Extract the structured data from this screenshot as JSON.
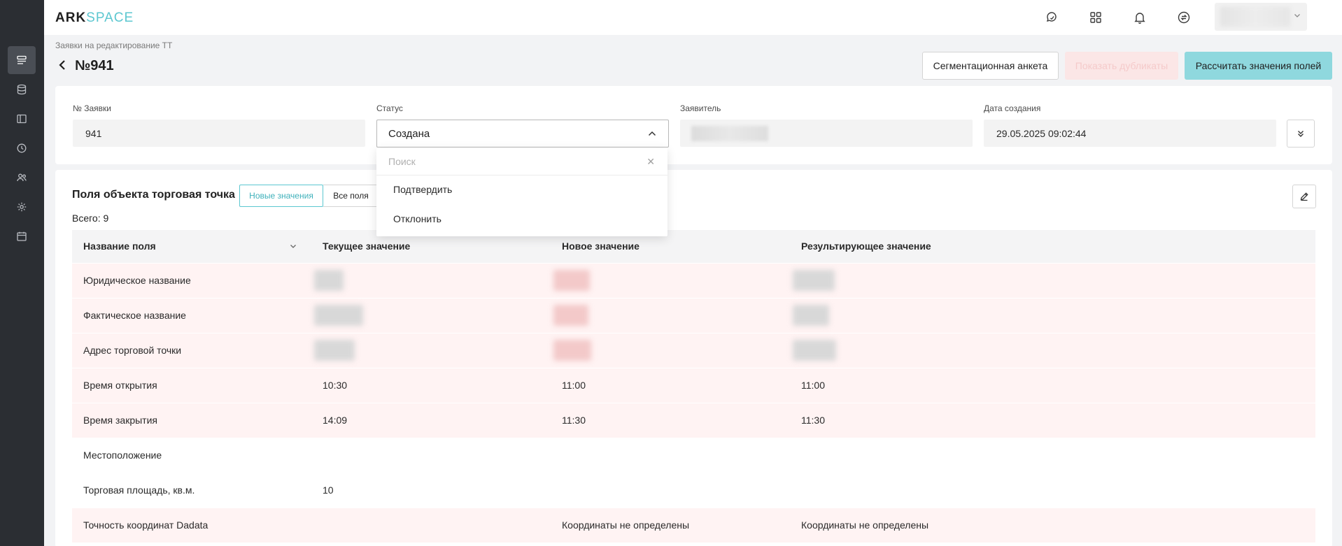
{
  "header": {
    "logo_primary": "ARK",
    "logo_secondary": "SPACE"
  },
  "breadcrumb": "Заявки на редактирование ТТ",
  "page": {
    "title": "№941"
  },
  "actions": {
    "segmentation": "Сегментационная анкета",
    "show_duplicates": "Показать дубликаты",
    "calculate": "Рассчитать значения полей"
  },
  "info": {
    "request_no_label": "№ Заявки",
    "request_no": "941",
    "status_label": "Статус",
    "status_value": "Создана",
    "applicant_label": "Заявитель",
    "created_label": "Дата создания",
    "created_value": "29.05.2025 09:02:44"
  },
  "status_dropdown": {
    "search_placeholder": "Поиск",
    "options": [
      "Подтвердить",
      "Отклонить"
    ]
  },
  "fields_section": {
    "title": "Поля объекта торговая точка",
    "tab_new": "Новые значения",
    "tab_all": "Все поля",
    "total": "Всего: 9",
    "columns": [
      "Название поля",
      "Текущее значение",
      "Новое значение",
      "Результирующее значение"
    ],
    "rows": [
      {
        "name": "Юридическое название",
        "current": "",
        "new": "",
        "result": ""
      },
      {
        "name": "Фактическое название",
        "current": "",
        "new": "",
        "result": ""
      },
      {
        "name": "Адрес торговой точки",
        "current": "",
        "new": "",
        "result": ""
      },
      {
        "name": "Время открытия",
        "current": "10:30",
        "new": "11:00",
        "result": "11:00"
      },
      {
        "name": "Время закрытия",
        "current": "14:09",
        "new": "11:30",
        "result": "11:30"
      },
      {
        "name": "Местоположение",
        "current": "",
        "new": "",
        "result": ""
      },
      {
        "name": "Торговая площадь, кв.м.",
        "current": "10",
        "new": "",
        "result": ""
      },
      {
        "name": "Точность координат Dadata",
        "current": "",
        "new": "Координаты не определены",
        "result": "Координаты не определены"
      }
    ]
  },
  "colors": {
    "accent": "#5cc7d0",
    "sidebar": "#2b2e33",
    "new_value": "#d6333a",
    "changed_row": "#fff3f3"
  }
}
